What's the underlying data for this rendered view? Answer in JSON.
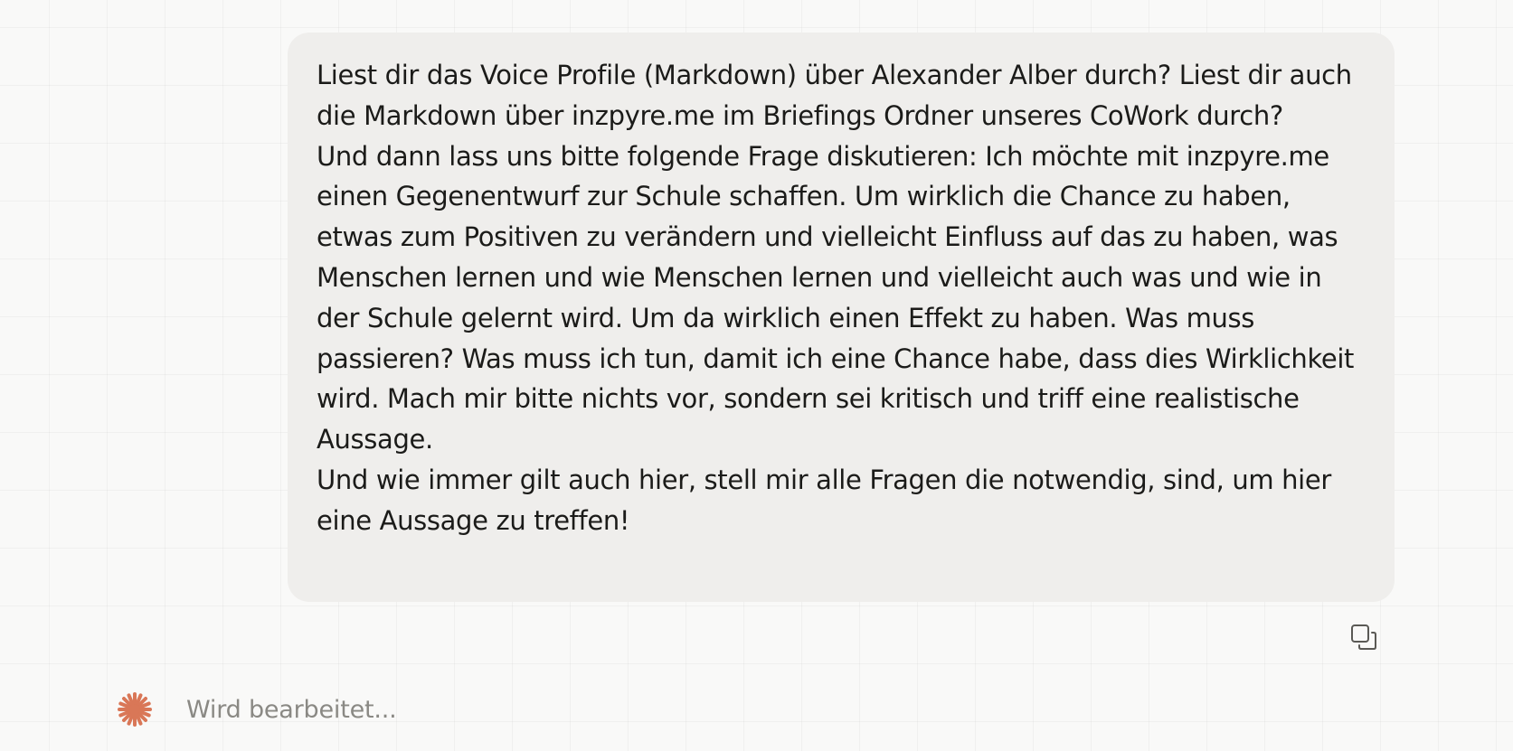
{
  "message": {
    "paragraphs": [
      "Liest dir das Voice Profile (Markdown) über Alexander Alber durch? Liest dir auch die Markdown über inzpyre.me im Briefings Ordner unseres CoWork durch?",
      "Und dann lass uns bitte folgende Frage diskutieren: Ich möchte mit inzpyre.me einen Gegenentwurf zur Schule schaffen. Um wirklich die Chance zu haben, etwas zum Positiven zu verändern und vielleicht Einfluss auf das zu haben, was Menschen lernen und wie Menschen lernen und vielleicht auch was und wie in der Schule gelernt wird. Um da wirklich einen Effekt zu haben. Was muss passieren? Was muss ich tun, damit ich eine Chance habe, dass dies Wirklichkeit wird. Mach mir bitte nichts vor, sondern sei kritisch und triff eine realistische Aussage.",
      "Und wie immer gilt auch hier, stell mir alle Fragen die notwendig, sind, um hier eine Aussage zu treffen!"
    ]
  },
  "actions": {
    "copy_icon": "copy-icon"
  },
  "status": {
    "text": "Wird bearbeitet...",
    "icon": "spark-icon",
    "icon_color": "#d97757"
  },
  "colors": {
    "background": "#f9f9f8",
    "bubble": "#efeeec",
    "text": "#1b1b19",
    "muted_text": "#8a8984"
  }
}
